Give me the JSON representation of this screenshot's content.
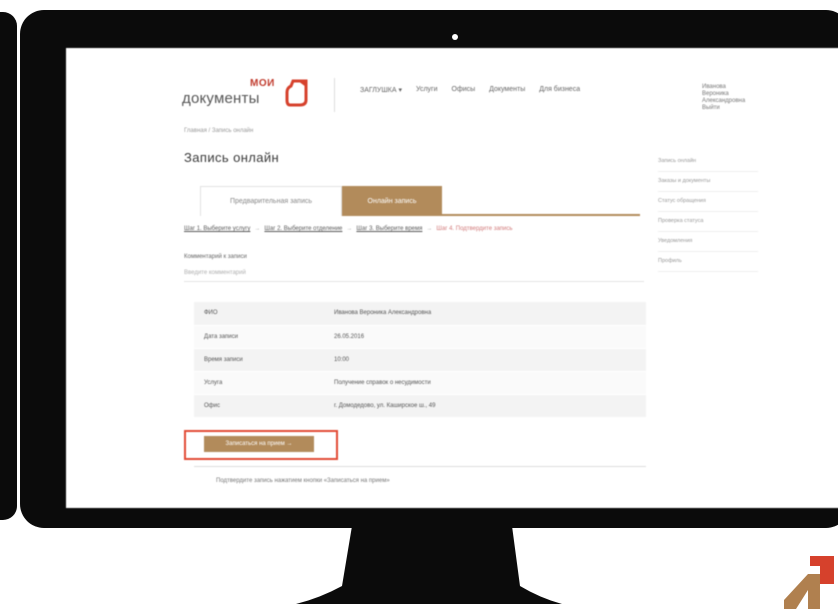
{
  "site": {
    "logo_top": "МОИ",
    "logo_bottom": "документы"
  },
  "topnav": [
    {
      "label": "ЗАГЛУШКА ▾"
    },
    {
      "label": "Услуги"
    },
    {
      "label": "Офисы"
    },
    {
      "label": "Документы"
    },
    {
      "label": "Для бизнеса"
    }
  ],
  "user": {
    "line1": "Иванова",
    "line2": "Вероника",
    "line3": "Александровна",
    "line4": "Выйти"
  },
  "breadcrumb": "Главная / Запись онлайн",
  "page_title": "Запись онлайн",
  "side_menu": [
    "Запись онлайн",
    "Заказы и документы",
    "Статус обращения",
    "Проверка статуса",
    "Уведомления",
    "Профиль"
  ],
  "tabs": {
    "inactive": "Предварительная запись",
    "active": "Онлайн запись"
  },
  "steps": {
    "step1": "Шаг 1. Выберите услугу",
    "step2": "Шаг 2. Выберите отделение",
    "step3": "Шаг 3. Выберите время",
    "step4": "Шаг 4. Подтвердите запись",
    "arrow": "→"
  },
  "comment": {
    "label": "Комментарий к записи",
    "placeholder": "Введите комментарий"
  },
  "summary": [
    {
      "key": "ФИО",
      "value": "Иванова Вероника Александровна"
    },
    {
      "key": "Дата записи",
      "value": "26.05.2016"
    },
    {
      "key": "Время записи",
      "value": "10:00"
    },
    {
      "key": "Услуга",
      "value": "Получение справок о несудимости"
    },
    {
      "key": "Офис",
      "value": "г. Домодедово, ул. Каширское ш., 49"
    }
  ],
  "submit_label": "Записаться на прием →",
  "footnote": "Подтвердите запись нажатием кнопки «Записаться на прием»",
  "colors": {
    "accent": "#b28b5b",
    "highlight": "#e24b35",
    "monitor": "#0b0b0b"
  }
}
